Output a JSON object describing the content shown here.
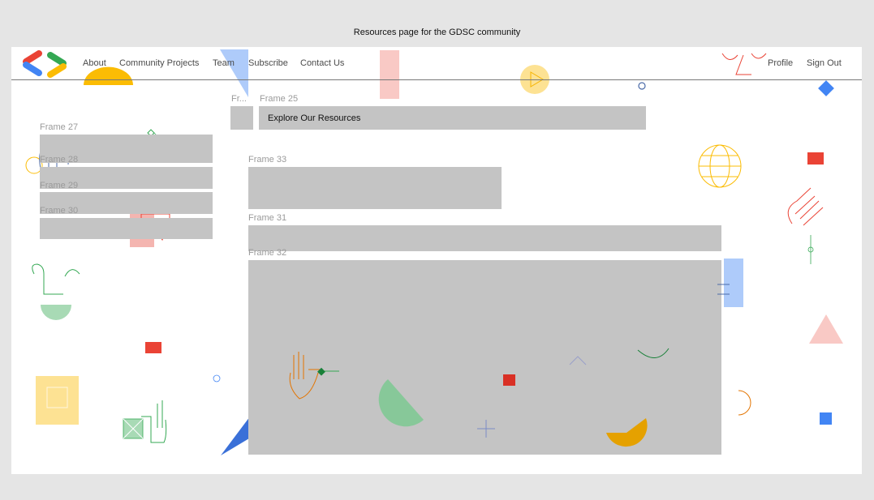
{
  "canvas": {
    "title": "Resources page for the GDSC community"
  },
  "nav": {
    "logo": "gdsc-logo-icon",
    "links": [
      "About",
      "Community Projects",
      "Team",
      "Subscribe",
      "Contact Us"
    ],
    "right_links": [
      "Profile",
      "Sign Out"
    ]
  },
  "frames": {
    "f25": {
      "label": "Frame 25",
      "button": "Explore Our Resources"
    },
    "f25_small": {
      "label": "Fr..."
    },
    "f27": {
      "label": "Frame 27"
    },
    "f28": {
      "label": "Frame 28"
    },
    "f29": {
      "label": "Frame 29"
    },
    "f30": {
      "label": "Frame 30"
    },
    "f31": {
      "label": "Frame 31"
    },
    "f32": {
      "label": "Frame 32"
    },
    "f33": {
      "label": "Frame 33"
    }
  },
  "colors": {
    "frame_fill": "#c4c4c4",
    "google_blue": "#4285f4",
    "google_red": "#ea4335",
    "google_yellow": "#fbbc04",
    "google_green": "#34a853",
    "page_bg": "#ffffff",
    "canvas_bg": "#e5e5e5"
  }
}
